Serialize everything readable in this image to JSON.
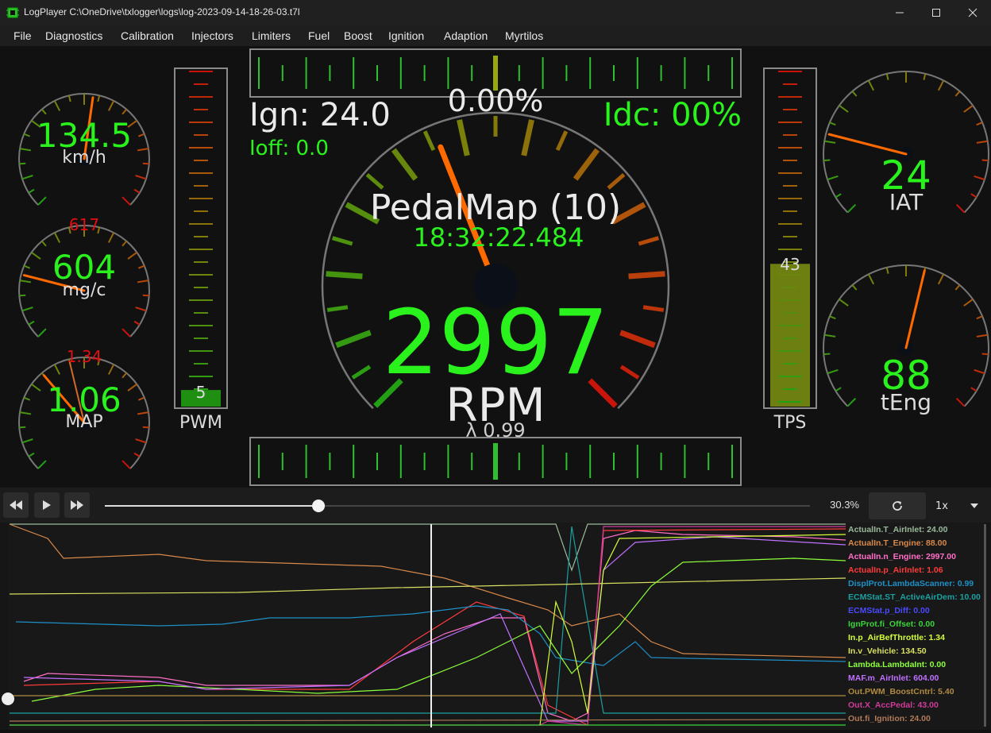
{
  "window": {
    "title": "LogPlayer C:\\OneDrive\\txlogger\\logs\\log-2023-09-14-18-26-03.t7l"
  },
  "menu": [
    "File",
    "Diagnostics",
    "Calibration",
    "Injectors",
    "Limiters",
    "Fuel",
    "Boost",
    "Ignition",
    "Adaption",
    "Myrtilos"
  ],
  "gauges": {
    "speed": {
      "value": "134.5",
      "unit": "km/h",
      "needle_fraction": 0.53
    },
    "maf": {
      "value": "604",
      "unit": "mg/c",
      "target": "617",
      "needle_fraction": 0.22
    },
    "map": {
      "value": "1.06",
      "unit": "MAP",
      "target": "1.34",
      "needle_fraction": 0.35,
      "target_fraction": 0.45
    },
    "iat": {
      "value": "24",
      "unit": "IAT",
      "needle_fraction": 0.22
    },
    "teng": {
      "value": "88",
      "unit": "tEng",
      "needle_fraction": 0.55
    }
  },
  "bars": {
    "pwm": {
      "label": "PWM",
      "value": "5",
      "fraction": 0.05
    },
    "tps": {
      "label": "TPS",
      "value": "43",
      "fraction": 0.43
    }
  },
  "center": {
    "top_bar_value": "0.00%",
    "ign": "Ign: 24.0",
    "ioff": "Ioff: 0.0",
    "idc": "Idc: 00%",
    "map_name": "PedalMap (10)",
    "time": "18:32:22.484",
    "rpm": "2997",
    "rpm_unit": "RPM",
    "lambda": "λ 0.99",
    "rpm_fraction": 0.42
  },
  "playback": {
    "position_fraction": 0.303,
    "percent": "30.3%",
    "speed": "1x"
  },
  "legend": [
    {
      "label": "ActualIn.T_AirInlet: 24.00",
      "color": "#9ab89a"
    },
    {
      "label": "ActualIn.T_Engine: 88.00",
      "color": "#d9894a"
    },
    {
      "label": "ActualIn.n_Engine: 2997.00",
      "color": "#ff6ec7"
    },
    {
      "label": "ActualIn.p_AirInlet: 1.06",
      "color": "#ff3a3a"
    },
    {
      "label": "DisplProt.LambdaScanner: 0.99",
      "color": "#1e90c8"
    },
    {
      "label": "ECMStat.ST_ActiveAirDem: 10.00",
      "color": "#1aa0a0"
    },
    {
      "label": "ECMStat.p_Diff: 0.00",
      "color": "#4a4aff"
    },
    {
      "label": "IgnProt.fi_Offset: 0.00",
      "color": "#3ad43a"
    },
    {
      "label": "In.p_AirBefThrottle: 1.34",
      "color": "#d4ff3a"
    },
    {
      "label": "In.v_Vehicle: 134.50",
      "color": "#d8e060"
    },
    {
      "label": "Lambda.LambdaInt: 0.00",
      "color": "#8cff3a"
    },
    {
      "label": "MAF.m_AirInlet: 604.00",
      "color": "#c070ff"
    },
    {
      "label": "Out.PWM_BoostCntrl: 5.40",
      "color": "#b08a40"
    },
    {
      "label": "Out.X_AccPedal: 43.00",
      "color": "#d03a9a"
    },
    {
      "label": "Out.fi_Ignition: 24.00",
      "color": "#b07a5a"
    }
  ],
  "colors": {
    "green": "#29f21d",
    "red": "#e01010",
    "orange": "#ff6a00",
    "olive": "#8fa31a"
  }
}
